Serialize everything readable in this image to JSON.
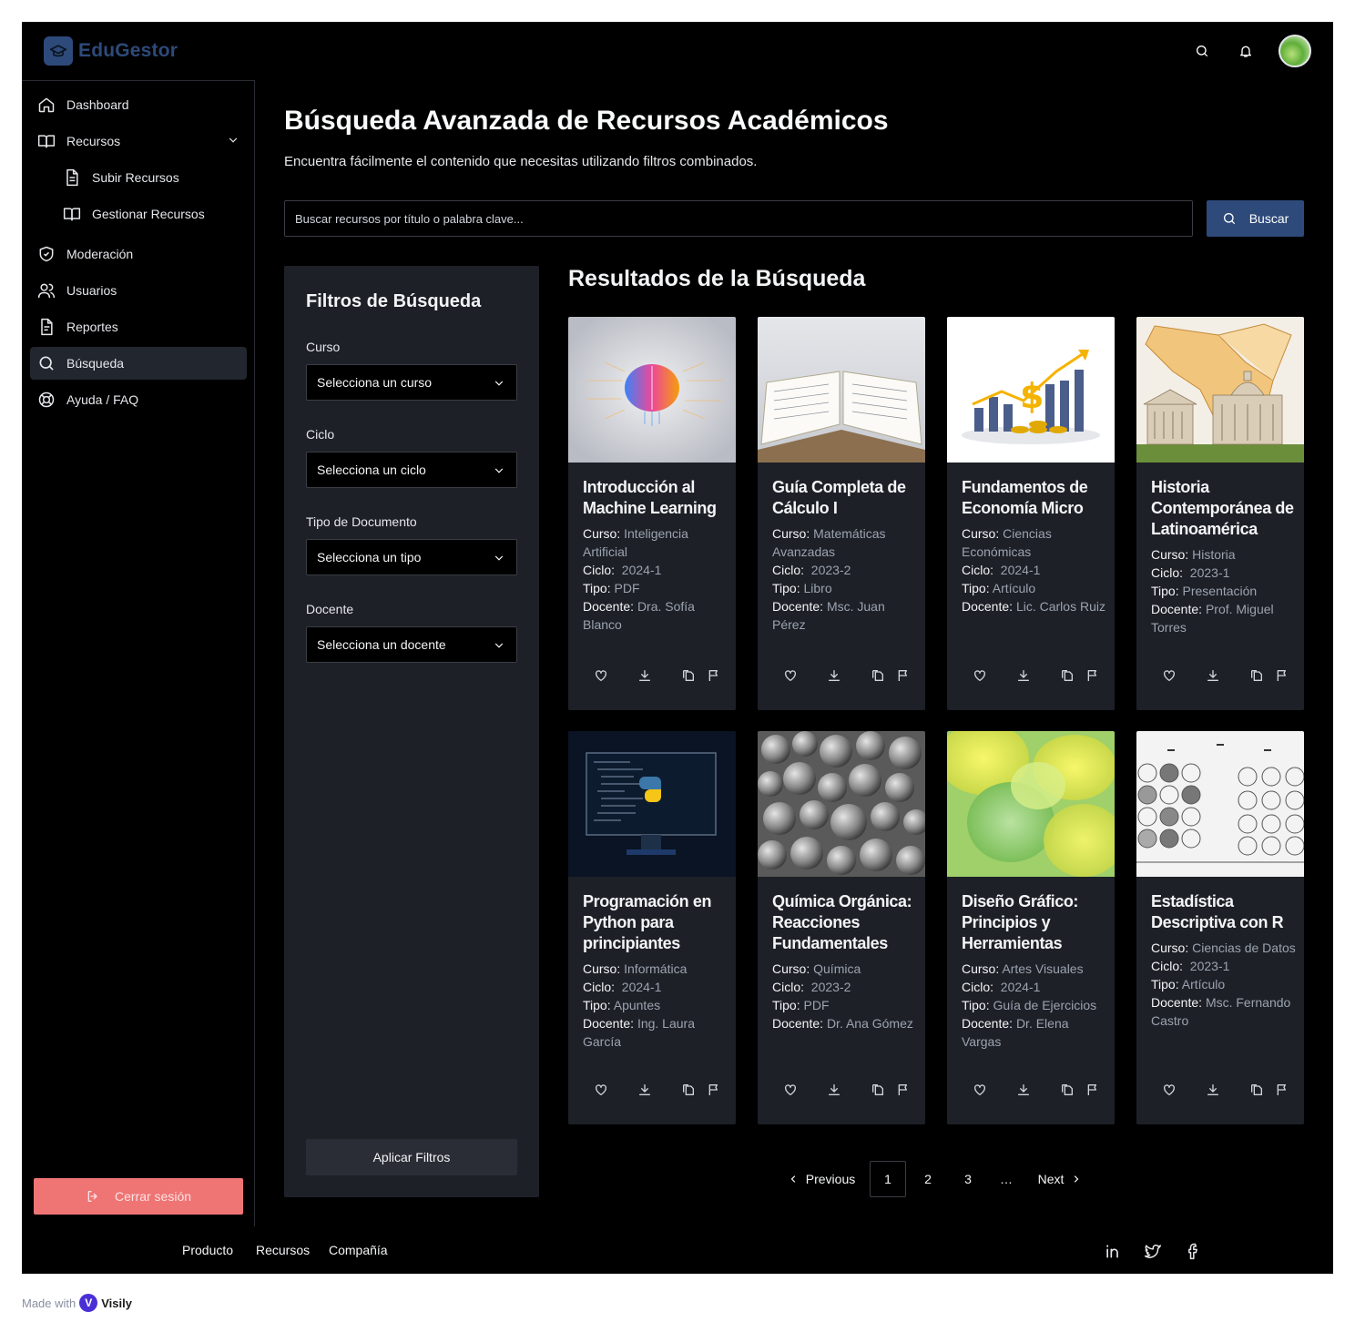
{
  "brand": {
    "name": "EduGestor"
  },
  "sidebar": {
    "items": [
      {
        "label": "Dashboard",
        "icon": "home-icon"
      },
      {
        "label": "Recursos",
        "icon": "book-open-icon"
      },
      {
        "label": "Subir Recursos",
        "icon": "file-text-icon"
      },
      {
        "label": "Gestionar Recursos",
        "icon": "book-open-icon"
      },
      {
        "label": "Moderación",
        "icon": "shield-check-icon"
      },
      {
        "label": "Usuarios",
        "icon": "users-icon"
      },
      {
        "label": "Reportes",
        "icon": "report-icon"
      },
      {
        "label": "Búsqueda",
        "icon": "search-icon"
      },
      {
        "label": "Ayuda / FAQ",
        "icon": "lifebuoy-icon"
      }
    ],
    "active": "Búsqueda",
    "logout_label": "Cerrar sesión"
  },
  "main": {
    "title": "Búsqueda Avanzada de Recursos Académicos",
    "subtitle": "Encuentra fácilmente el contenido que necesitas utilizando filtros combinados.",
    "search_placeholder": "Buscar recursos por título o palabra clave...",
    "search_button": "Buscar"
  },
  "filters": {
    "title": "Filtros de Búsqueda",
    "fields": [
      {
        "label": "Curso",
        "value": "Selecciona un curso"
      },
      {
        "label": "Ciclo",
        "value": "Selecciona un ciclo"
      },
      {
        "label": "Tipo de Documento",
        "value": "Selecciona un tipo"
      },
      {
        "label": "Docente",
        "value": "Selecciona un docente"
      }
    ],
    "apply_button": "Aplicar Filtros"
  },
  "results": {
    "title": "Resultados de la Búsqueda",
    "labels": {
      "curso": "Curso:",
      "ciclo": "Ciclo:",
      "tipo": "Tipo:",
      "docente": "Docente:"
    },
    "cards": [
      {
        "title": "Introducción al Machine Learning",
        "curso": "Inteligencia Artificial",
        "ciclo": "2024-1",
        "tipo": "PDF",
        "docente": "Dra. Sofía Blanco",
        "image": "ai-brain"
      },
      {
        "title": "Guía Completa de Cálculo I",
        "curso": "Matemáticas Avanzadas",
        "ciclo": "2023-2",
        "tipo": "Libro",
        "docente": "Msc. Juan Pérez",
        "image": "open-book"
      },
      {
        "title": "Fundamentos de Economía Micro",
        "curso": "Ciencias Económicas",
        "ciclo": "2024-1",
        "tipo": "Artículo",
        "docente": "Lic. Carlos Ruiz",
        "image": "economy-chart"
      },
      {
        "title": "Historia Contemporánea de Latinoamérica",
        "curso": "Historia",
        "ciclo": "2023-1",
        "tipo": "Presentación",
        "docente": "Prof. Miguel Torres",
        "image": "latam-map"
      },
      {
        "title": "Programación en Python para principiantes",
        "curso": "Informática",
        "ciclo": "2024-1",
        "tipo": "Apuntes",
        "docente": "Ing. Laura García",
        "image": "python-monitor"
      },
      {
        "title": "Química Orgánica: Reacciones Fundamentales",
        "curso": "Química",
        "ciclo": "2023-2",
        "tipo": "PDF",
        "docente": "Dr. Ana Gómez",
        "image": "molecules"
      },
      {
        "title": "Diseño Gráfico: Principios y Herramientas",
        "curso": "Artes Visuales",
        "ciclo": "2024-1",
        "tipo": "Guía de Ejercicios",
        "docente": "Dr. Elena Vargas",
        "image": "abstract-shapes"
      },
      {
        "title": "Estadística Descriptiva con R",
        "curso": "Ciencias de Datos",
        "ciclo": "2023-1",
        "tipo": "Artículo",
        "docente": "Msc. Fernando Castro",
        "image": "statistics-plots"
      }
    ]
  },
  "pagination": {
    "previous": "Previous",
    "pages": [
      "1",
      "2",
      "3"
    ],
    "ellipsis": "…",
    "next": "Next",
    "current": "1"
  },
  "footer": {
    "links": [
      "Producto",
      "Recursos",
      "Compañía"
    ],
    "social": [
      "linkedin-icon",
      "twitter-icon",
      "facebook-icon"
    ]
  },
  "made_with": {
    "prefix": "Made with",
    "brand": "Visily"
  },
  "colors": {
    "accent": "#2d4a7a",
    "logout": "#ef7474",
    "panel": "#1d2027",
    "background": "#000000"
  }
}
